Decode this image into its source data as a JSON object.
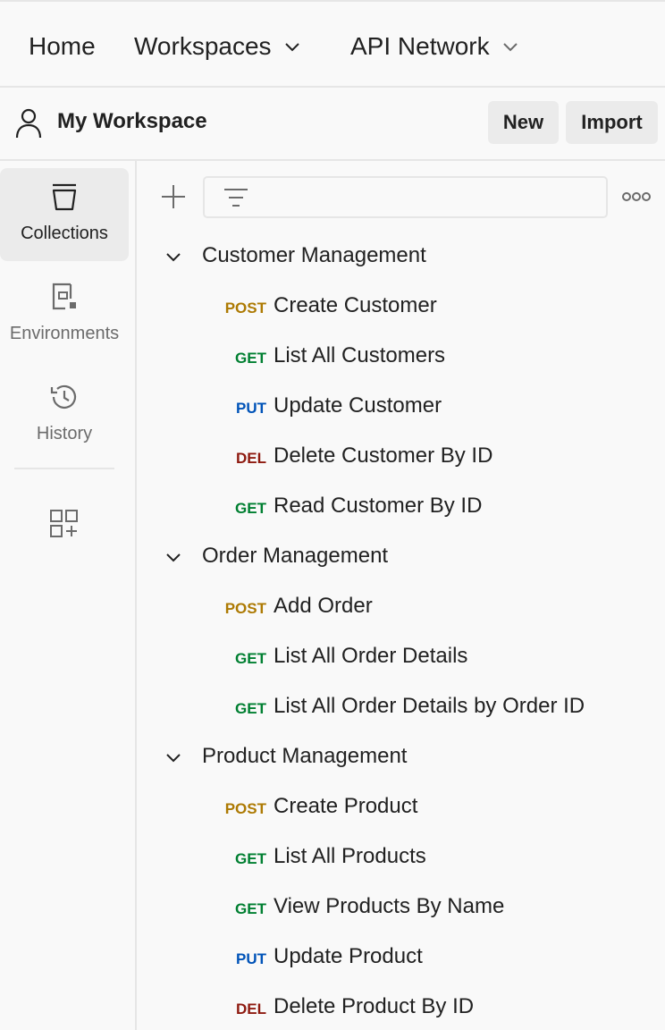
{
  "topnav": {
    "home": "Home",
    "workspaces": "Workspaces",
    "api_network": "API Network"
  },
  "workspace": {
    "title": "My Workspace",
    "new_label": "New",
    "import_label": "Import"
  },
  "sidebar": {
    "items": [
      {
        "label": "Collections",
        "icon": "collections-icon",
        "active": true
      },
      {
        "label": "Environments",
        "icon": "environments-icon",
        "active": false
      },
      {
        "label": "History",
        "icon": "history-icon",
        "active": false
      }
    ]
  },
  "filter": {
    "placeholder": ""
  },
  "method_colors": {
    "POST": "#ad7a03",
    "GET": "#007f31",
    "PUT": "#0053b8",
    "DEL": "#8e1a10"
  },
  "collections": [
    {
      "name": "Customer Management",
      "requests": [
        {
          "method": "POST",
          "name": "Create Customer"
        },
        {
          "method": "GET",
          "name": "List All Customers"
        },
        {
          "method": "PUT",
          "name": "Update Customer"
        },
        {
          "method": "DEL",
          "name": "Delete Customer By ID"
        },
        {
          "method": "GET",
          "name": "Read Customer By ID"
        }
      ]
    },
    {
      "name": "Order Management",
      "requests": [
        {
          "method": "POST",
          "name": "Add Order"
        },
        {
          "method": "GET",
          "name": "List All Order Details"
        },
        {
          "method": "GET",
          "name": "List All Order Details by Order ID"
        }
      ]
    },
    {
      "name": "Product Management",
      "requests": [
        {
          "method": "POST",
          "name": "Create Product"
        },
        {
          "method": "GET",
          "name": "List All Products"
        },
        {
          "method": "GET",
          "name": "View Products By Name"
        },
        {
          "method": "PUT",
          "name": "Update Product"
        },
        {
          "method": "DEL",
          "name": "Delete Product By ID"
        }
      ]
    }
  ]
}
